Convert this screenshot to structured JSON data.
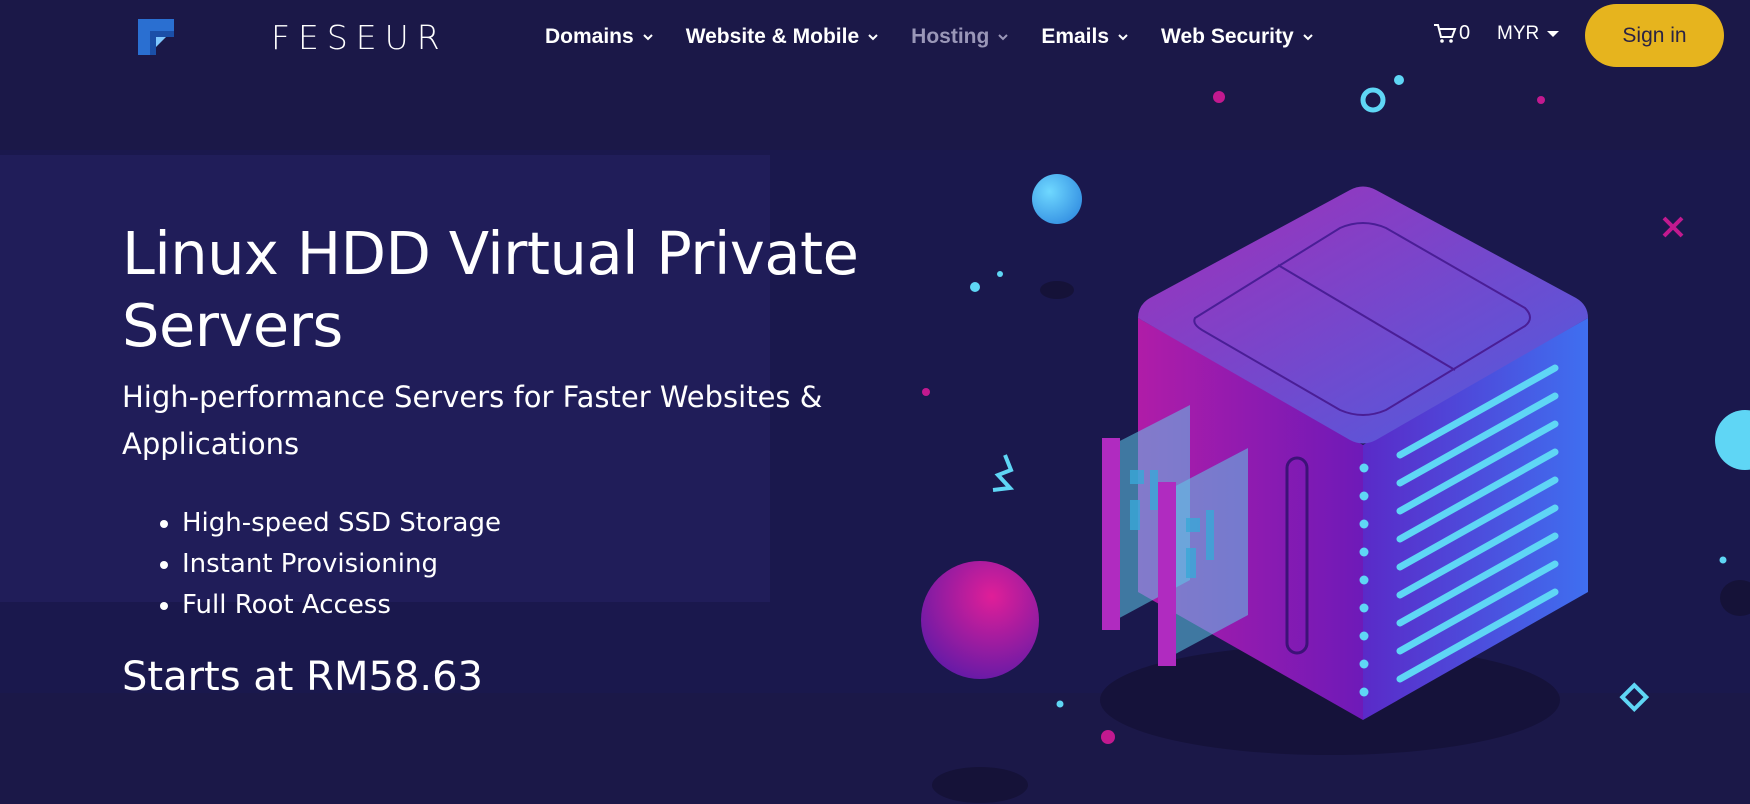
{
  "brand": {
    "name": "FESEUR",
    "logo_icon": "feseur-logo-icon"
  },
  "nav": {
    "items": [
      {
        "label": "Domains",
        "active": false
      },
      {
        "label": "Website & Mobile",
        "active": false
      },
      {
        "label": "Hosting",
        "active": true
      },
      {
        "label": "Emails",
        "active": false
      },
      {
        "label": "Web Security",
        "active": false
      }
    ],
    "cart_icon": "cart-icon",
    "cart_count": "0",
    "currency": "MYR",
    "sign_in": "Sign in"
  },
  "hero": {
    "title": "Linux HDD Virtual Private Servers",
    "subtitle": "High-performance Servers for Faster Websites & Applications",
    "features": [
      "High-speed SSD Storage",
      "Instant Provisioning",
      "Full Root Access"
    ],
    "price": "Starts at RM58.63",
    "illustration": "server-cube-illustration"
  },
  "colors": {
    "background": "#1b1848",
    "accent_button": "#e6b41e",
    "nav_muted": "#9a97b8",
    "cyan": "#5fd6f5",
    "magenta": "#c2198f"
  }
}
